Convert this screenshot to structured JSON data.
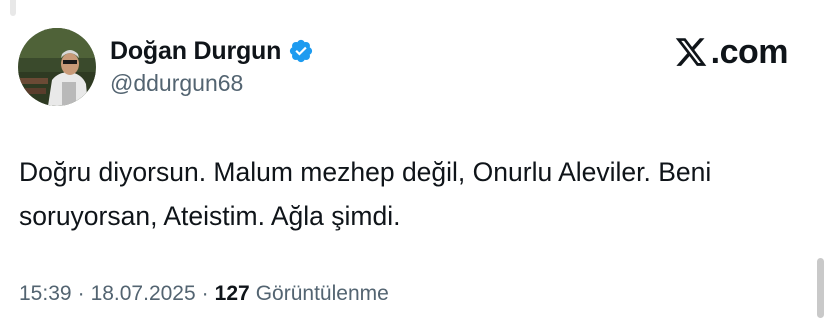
{
  "author": {
    "display_name": "Doğan Durgun",
    "handle": "@ddurgun68",
    "verified": true,
    "verified_color": "#1d9bf0"
  },
  "brand": {
    "icon": "x-logo-icon",
    "domain": ".com"
  },
  "tweet": {
    "text": "Doğru diyorsun. Malum mezhep değil, Onurlu Aleviler. Beni\nsoruyorsan, Ateistim. Ağla şimdi."
  },
  "meta": {
    "time": "15:39",
    "date": "18.07.2025",
    "separator": "·",
    "views_count": "127",
    "views_label": "Görüntülenme"
  }
}
